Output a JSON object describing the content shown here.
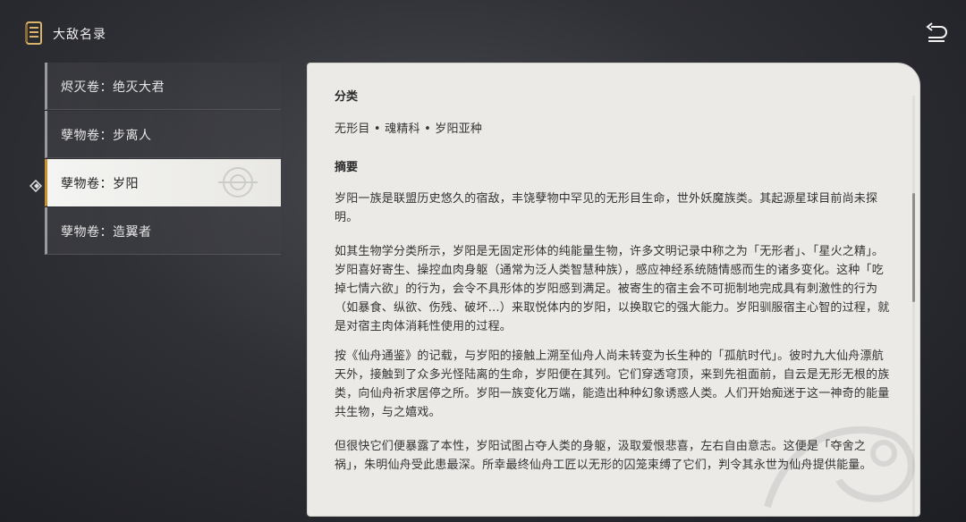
{
  "header": {
    "title": "大敌名录",
    "icon": "book-icon",
    "back_icon": "return-arrow-icon"
  },
  "sidebar": {
    "items": [
      {
        "label": "烬灭卷：绝灭大君",
        "selected": false
      },
      {
        "label": "孽物卷：步离人",
        "selected": false
      },
      {
        "label": "孽物卷：岁阳",
        "selected": true
      },
      {
        "label": "孽物卷：造翼者",
        "selected": false
      }
    ]
  },
  "content": {
    "classification_title": "分类",
    "classification_text": "无形目 • 魂精科 • 岁阳亚种",
    "summary_title": "摘要",
    "paragraphs": [
      "岁阳一族是联盟历史悠久的宿敌，丰饶孽物中罕见的无形目生命，世外妖魔族类。其起源星球目前尚未探明。",
      "如其生物学分类所示，岁阳是无固定形体的纯能量生物，许多文明记录中称之为「无形者」、「星火之精」。岁阳喜好寄生、操控血肉身躯（通常为泛人类智慧种族），感应神经系统随情感而生的诸多变化。这种「吃掉七情六欲」的行为，会令不具形体的岁阳感到满足。被寄生的宿主会不可扼制地完成具有刺激性的行为（如暴食、纵欲、伤残、破坏…）来取悦体内的岁阳，以换取它的强大能力。岁阳驯服宿主心智的过程，就是对宿主肉体消耗性使用的过程。",
      "按《仙舟通鉴》的记载，与岁阳的接触上溯至仙舟人尚未转变为长生种的「孤航时代」。彼时九大仙舟漂航天外，接触到了众多光怪陆离的生命，岁阳便在其列。它们穿透穹顶，来到先祖面前，自云是无形无根的族类，向仙舟祈求居停之所。岁阳一族变化万端，能造出种种幻象诱惑人类。人们开始痴迷于这一神奇的能量共生物，与之嬉戏。",
      "但很快它们便暴露了本性，岁阳试图占夺人类的身躯，汲取爱恨悲喜，左右自由意志。这便是「夺舍之祸」，朱明仙舟受此患最深。所幸最终仙舟工匠以无形的囚笼束缚了它们，判令其永世为仙舟提供能量。"
    ]
  },
  "colors": {
    "accent": "#c9902f",
    "panel_bg": "#ebeae7",
    "selected_bg": "#f4f4f2"
  }
}
